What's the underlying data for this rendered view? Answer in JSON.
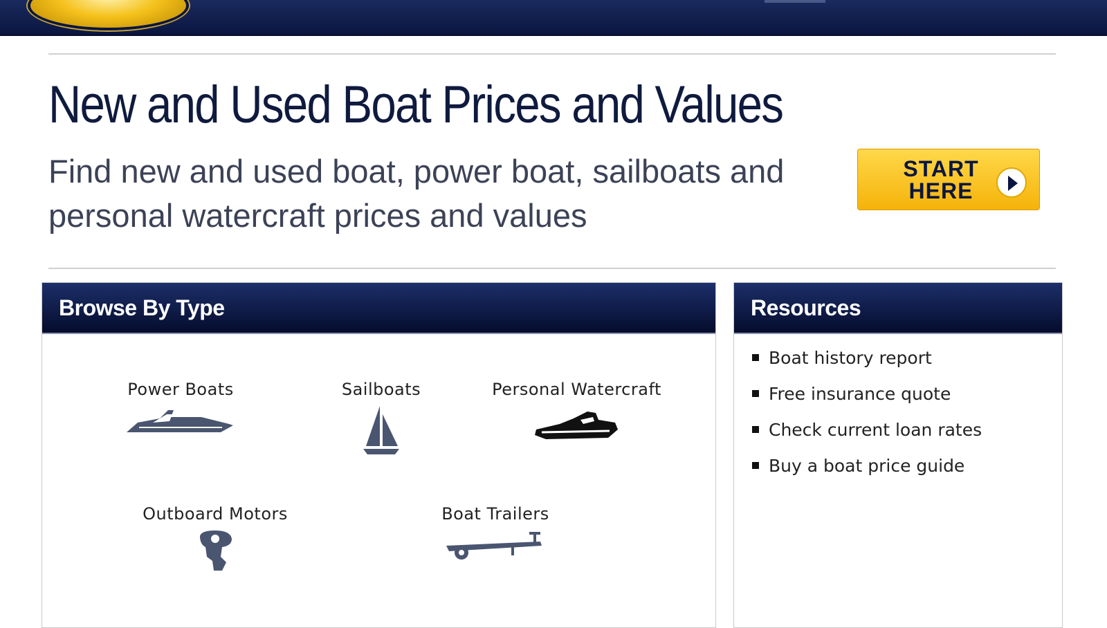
{
  "header": {
    "title": "New and Used Boat Prices and Values",
    "subtitle": "Find new and used boat, power boat, sailboats and personal watercraft prices and values",
    "cta_label_line1": "START",
    "cta_label_line2": "HERE"
  },
  "browse": {
    "heading": "Browse By Type",
    "types": [
      {
        "label": "Power Boats",
        "icon": "power-boat-icon"
      },
      {
        "label": "Sailboats",
        "icon": "sailboat-icon"
      },
      {
        "label": "Personal Watercraft",
        "icon": "personal-watercraft-icon"
      },
      {
        "label": "Outboard Motors",
        "icon": "outboard-motor-icon"
      },
      {
        "label": "Boat Trailers",
        "icon": "boat-trailer-icon"
      }
    ]
  },
  "resources": {
    "heading": "Resources",
    "items": [
      "Boat history report",
      "Free insurance quote",
      "Check current loan rates",
      "Buy a boat price guide"
    ]
  },
  "colors": {
    "navy": "#0b1640",
    "accent_yellow": "#f5b30a",
    "icon_gray": "#4a5570"
  }
}
